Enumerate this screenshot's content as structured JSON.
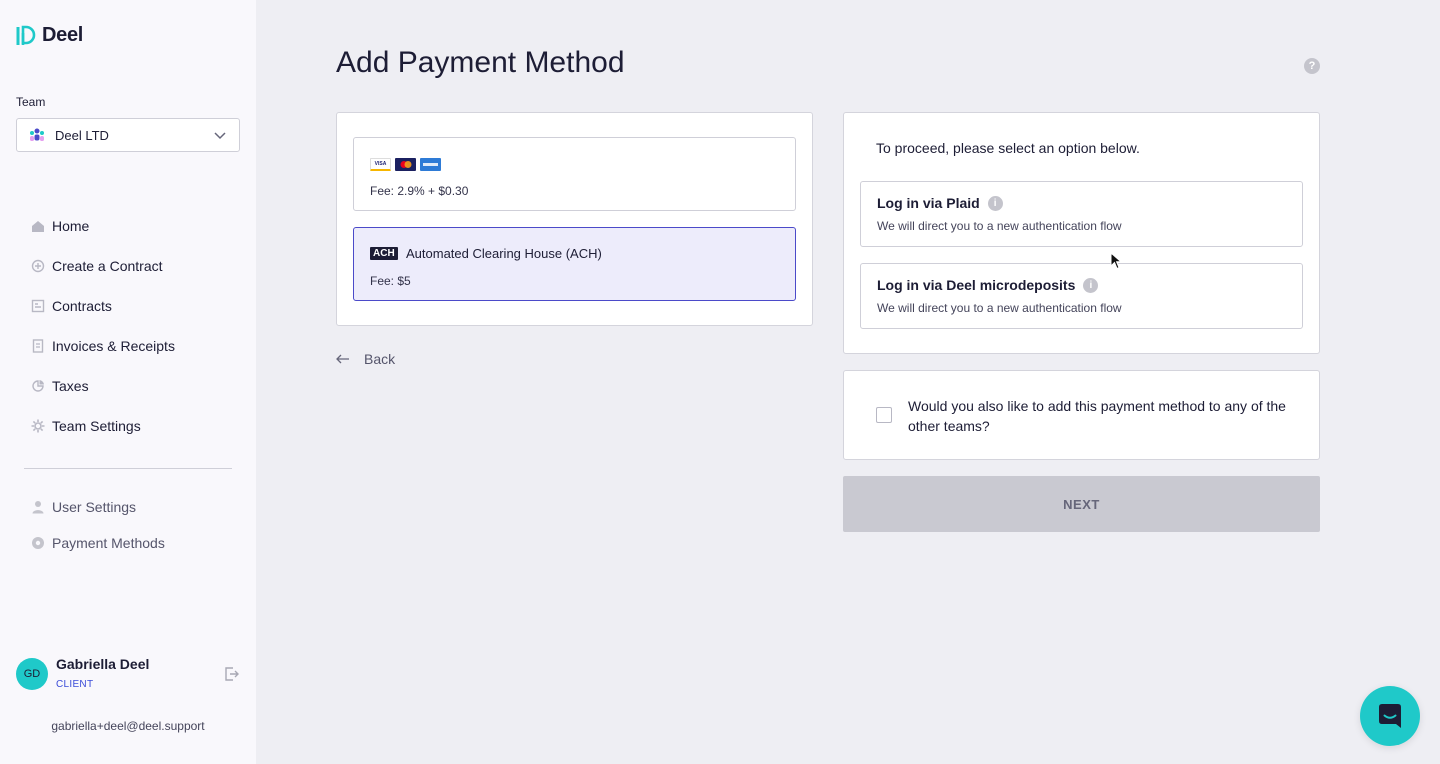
{
  "app": {
    "name": "Deel"
  },
  "sidebar": {
    "team_label": "Team",
    "team_name": "Deel LTD",
    "nav": [
      {
        "label": "Home",
        "icon": "home-icon"
      },
      {
        "label": "Create a Contract",
        "icon": "plus-circle-icon"
      },
      {
        "label": "Contracts",
        "icon": "contract-icon"
      },
      {
        "label": "Invoices & Receipts",
        "icon": "invoice-icon"
      },
      {
        "label": "Taxes",
        "icon": "pie-chart-icon"
      },
      {
        "label": "Team Settings",
        "icon": "gear-icon"
      }
    ],
    "nav_secondary": [
      {
        "label": "User Settings",
        "icon": "user-icon"
      },
      {
        "label": "Payment Methods",
        "icon": "payment-icon"
      }
    ],
    "user": {
      "initials": "GD",
      "name": "Gabriella Deel",
      "role": "CLIENT",
      "email": "gabriella+deel@deel.support"
    }
  },
  "main": {
    "title": "Add Payment Method",
    "card_option": {
      "brands": [
        "VISA",
        "Mastercard",
        "American Express"
      ],
      "fee": "Fee: 2.9% + $0.30"
    },
    "ach_option": {
      "badge": "ACH",
      "label": "Automated Clearing House (ACH)",
      "fee": "Fee: $5",
      "selected": true
    },
    "back_label": "Back",
    "proceed_text": "To proceed, please select an option below.",
    "login_options": [
      {
        "title": "Log in via Plaid",
        "subtitle": "We will direct you to a new authentication flow"
      },
      {
        "title": "Log in via Deel microdeposits",
        "subtitle": "We will direct you to a new authentication flow"
      }
    ],
    "other_teams_text": "Would you also like to add this payment method to any of the other teams?",
    "other_teams_checked": false,
    "next_label": "NEXT",
    "next_disabled": true
  },
  "colors": {
    "accent": "#1fc9c9",
    "selected_border": "#4b4ac9",
    "selected_bg": "#edecfb"
  }
}
